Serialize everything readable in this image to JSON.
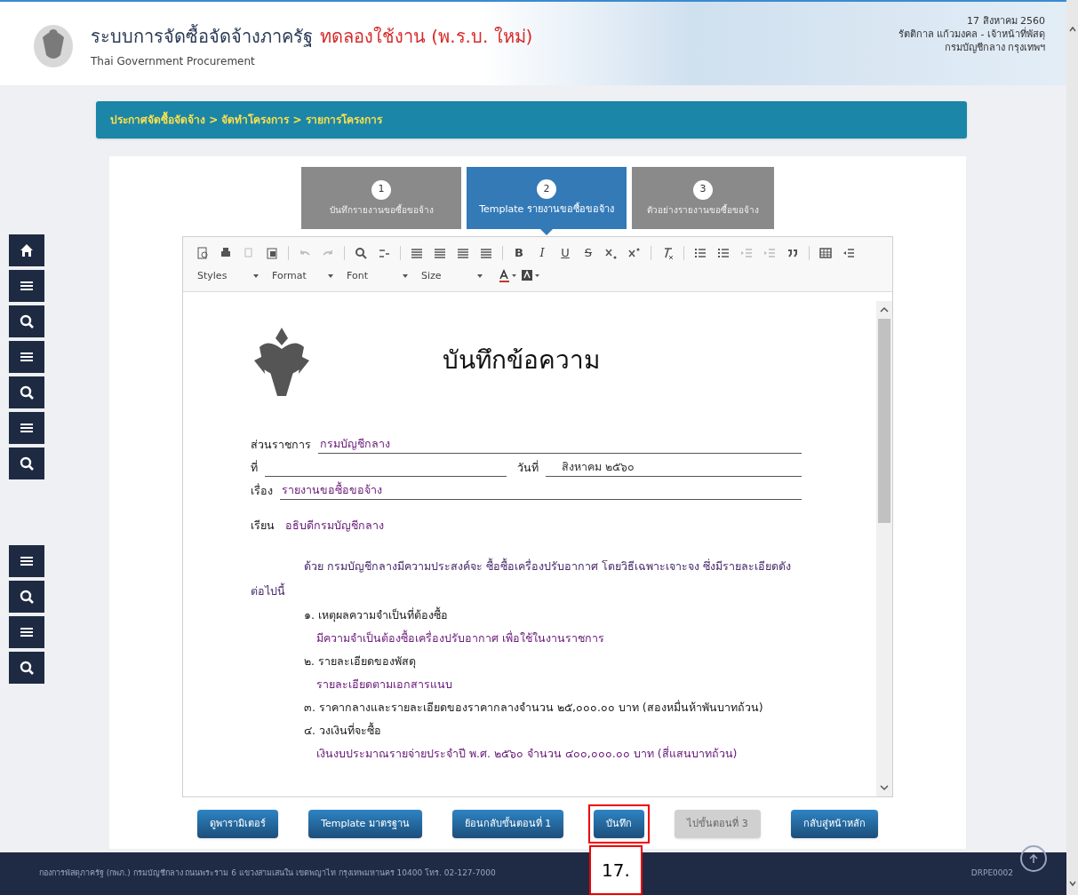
{
  "header": {
    "title": "ระบบการจัดซื้อจัดจ้างภาครัฐ",
    "title_badge": "ทดลองใช้งาน (พ.ร.บ. ใหม่)",
    "subtitle": "Thai Government Procurement",
    "user_lines": [
      "17 สิงหาคม 2560",
      "รัตติกาล แก้วมงคล - เจ้าหน้าที่พัสดุ",
      "กรมบัญชีกลาง กรุงเทพฯ"
    ]
  },
  "breadcrumb": "ประกาศจัดซื้อจัดจ้าง > จัดทำโครงการ > รายการโครงการ",
  "steps": [
    {
      "number": "1",
      "label": "บันทึกรายงานขอซื้อขอจ้าง",
      "selected": false
    },
    {
      "number": "2",
      "label": "Template รายงานขอซื้อขอจ้าง",
      "selected": true
    },
    {
      "number": "3",
      "label": "ตัวอย่างรายงานขอซื้อขอจ้าง",
      "selected": false
    }
  ],
  "toolbar": {
    "format_letters": [
      "B",
      "I",
      "U",
      "S"
    ],
    "dropdowns": [
      "Styles",
      "Format",
      "Font",
      "Size"
    ]
  },
  "document": {
    "heading": "บันทึกข้อความ",
    "fields": [
      {
        "label": "ส่วนราชการ",
        "value": "กรมบัญชีกลาง"
      },
      {
        "label": "ที่",
        "date_label": "วันที่",
        "date_value": "สิงหาคม ๒๕๖๐"
      },
      {
        "label": "เรื่อง",
        "value": "รายงานขอซื้อขอจ้าง"
      }
    ],
    "to_label": "เรียน",
    "to_value": "อธิบดีกรมบัญชีกลาง",
    "intro": "ด้วย กรมบัญชีกลางมีความประสงค์จะ ซื้อซื้อเครื่องปรับอากาศ โดยวิธีเฉพาะเจาะจง ซึ่งมีรายละเอียดดังต่อไปนี้",
    "items": [
      {
        "title": "๑. เหตุผลความจำเป็นที่ต้องซื้อ",
        "detail": "มีความจำเป็นต้องซื้อเครื่องปรับอากาศ เพื่อใช้ในงานราชการ"
      },
      {
        "title": "๒. รายละเอียดของพัสดุ",
        "detail": "รายละเอียดตามเอกสารแนบ"
      },
      {
        "title": "๓. ราคากลางและรายละเอียดของราคากลางจำนวน ๒๕,๐๐๐.๐๐ บาท (สองหมื่นห้าพันบาทถ้วน)"
      },
      {
        "title": "๔. วงเงินที่จะซื้อ",
        "detail": "เงินงบประมาณรายจ่ายประจำปี พ.ศ. ๒๕๖๐ จำนวน ๔๐๐,๐๐๐.๐๐ บาท (สี่แสนบาทถ้วน)"
      }
    ]
  },
  "buttons": [
    {
      "label": "ดูพารามิเตอร์",
      "disabled": false,
      "highlighted": false
    },
    {
      "label": "Template มาตรฐาน",
      "disabled": false,
      "highlighted": false
    },
    {
      "label": "ย้อนกลับขั้นตอนที่ 1",
      "disabled": false,
      "highlighted": false
    },
    {
      "label": "บันทึก",
      "disabled": false,
      "highlighted": true
    },
    {
      "label": "ไปขั้นตอนที่ 3",
      "disabled": true,
      "highlighted": false
    },
    {
      "label": "กลับสู่หน้าหลัก",
      "disabled": false,
      "highlighted": false
    }
  ],
  "callout": "17.",
  "footer": {
    "text": "กองการพัสดุภาครัฐ (กพภ.) กรมบัญชีกลาง ถนนพระราม 6 แขวงสามเสนใน เขตพญาไท กรุงเทพมหานคร 10400 โทร. 02-127-7000",
    "code": "DRPE0002"
  }
}
